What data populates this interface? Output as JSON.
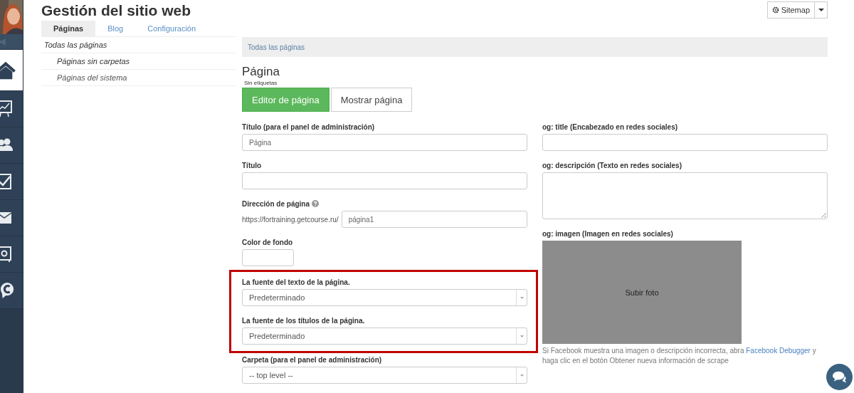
{
  "rail": {
    "items": [
      {
        "kind": "sound",
        "selected": false
      },
      {
        "kind": "home",
        "selected": true
      },
      {
        "kind": "chart",
        "selected": false
      },
      {
        "kind": "users",
        "selected": false
      },
      {
        "kind": "check",
        "selected": false
      },
      {
        "kind": "mail",
        "selected": false
      },
      {
        "kind": "safe",
        "selected": false
      },
      {
        "kind": "chat",
        "selected": false
      }
    ]
  },
  "header": {
    "title": "Gestión del sitio web",
    "sitemap_button": "Sitemap"
  },
  "tabs": [
    {
      "label": "Páginas",
      "selected": true
    },
    {
      "label": "Blog",
      "selected": false
    },
    {
      "label": "Configuración",
      "selected": false
    }
  ],
  "nav": [
    {
      "label": "Todas las páginas",
      "selected": true,
      "children": [
        {
          "label": "Páginas sin carpetas",
          "selected": true
        },
        {
          "label": "Páginas del sistema",
          "selected": false
        }
      ]
    }
  ],
  "breadcrumb": "Todas las páginas",
  "page": {
    "title": "Página",
    "tags": "Sin etiquetas",
    "buttons": [
      {
        "label": "Editor de página",
        "selected": true
      },
      {
        "label": "Mostrar página",
        "selected": false
      }
    ]
  },
  "left_fields": [
    {
      "kind": "input",
      "label": "Título (para el panel de administración)",
      "placeholder": "Página",
      "highlighted": false
    },
    {
      "kind": "input",
      "label": "Título",
      "highlighted": false
    },
    {
      "kind": "url",
      "label": "Dirección de página",
      "prefix": "https://fortraining.getcourse.ru/",
      "placeholder": "página1",
      "highlighted": false
    },
    {
      "kind": "color",
      "label": "Color de fondo",
      "highlighted": false
    },
    {
      "kind": "select",
      "label": "La fuente del texto de la página.",
      "value": "Predeterminado",
      "highlighted": true
    },
    {
      "kind": "select",
      "label": "La fuente de los títulos de la página.",
      "value": "Predeterminado",
      "highlighted": true
    },
    {
      "kind": "select",
      "label": "Carpeta (para el panel de administración)",
      "value": "-- top level --",
      "highlighted": false
    }
  ],
  "right_fields": [
    {
      "kind": "input",
      "label": "og: title (Encabezado en redes sociales)"
    },
    {
      "kind": "textarea",
      "label": "og: descripción (Texto en redes sociales)"
    },
    {
      "label": "og: imagen (Imagen en redes sociales)",
      "upload": "Subir foto",
      "help_before": "Si Facebook muestra una imagen o descripción incorrecta, abra ",
      "help_link": "Facebook Debugger",
      "help_after": " y haga clic en el botón Obtener nueva información de scrape"
    }
  ]
}
